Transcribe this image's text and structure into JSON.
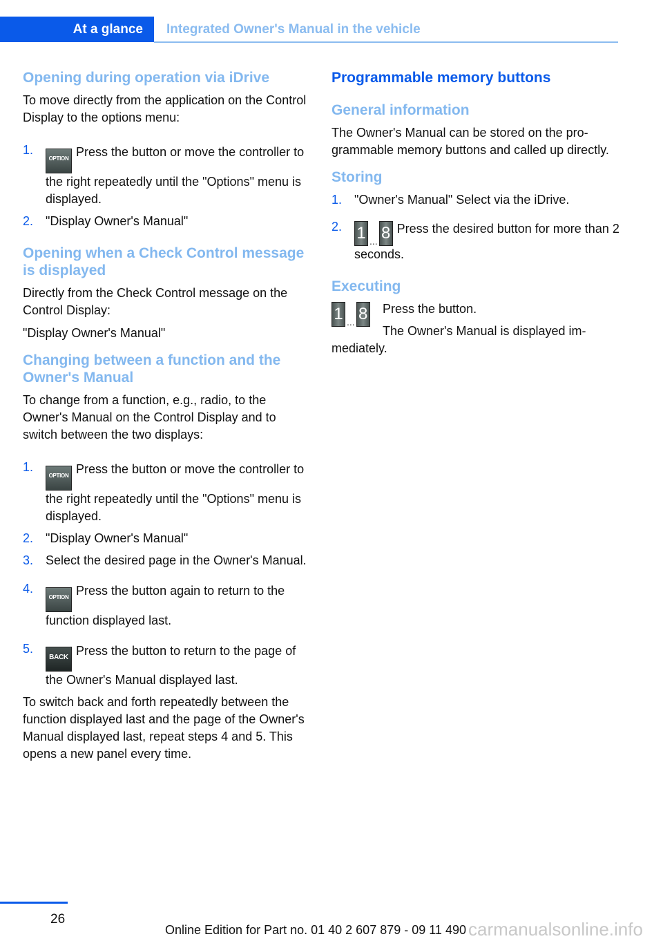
{
  "header": {
    "section_tab": "At a glance",
    "chapter_title": "Integrated Owner's Manual in the vehicle",
    "accent_color": "#0a5ae9",
    "light_accent_color": "#8bbcf0"
  },
  "left": {
    "s1": {
      "title": "Opening during operation via iDrive",
      "intro": "To move directly from the application on the Control Display to the options menu:",
      "steps": [
        {
          "num": "1.",
          "button": "OPTION",
          "text": "Press the button or move the controller to the right repeatedly until the \"Options\" menu is displayed."
        },
        {
          "num": "2.",
          "text": "\"Display Owner's Manual\""
        }
      ]
    },
    "s2": {
      "title": "Opening when a Check Control message is displayed",
      "p1": "Directly from the Check Control message on the Control Display:",
      "p2": "\"Display Owner's Manual\""
    },
    "s3": {
      "title": "Changing between a function and the Owner's Manual",
      "intro": "To change from a function, e.g., radio, to the Owner's Manual on the Control Display and to switch between the two displays:",
      "steps": [
        {
          "num": "1.",
          "button": "OPTION",
          "text": "Press the button or move the controller to the right repeatedly until the \"Options\" menu is displayed."
        },
        {
          "num": "2.",
          "text": "\"Display Owner's Manual\""
        },
        {
          "num": "3.",
          "text": "Select the desired page in the Owner's Manual."
        },
        {
          "num": "4.",
          "button": "OPTION",
          "text": "Press the button again to return to the function displayed last."
        },
        {
          "num": "5.",
          "button": "BACK",
          "text": "Press the button to return to the page of the Owner's Manual displayed last."
        }
      ],
      "outro": "To switch back and forth repeatedly between the function displayed last and the page of the Owner's Manual displayed last, repeat steps 4 and 5. This opens a new panel every time."
    }
  },
  "right": {
    "title": "Programmable memory buttons",
    "general": {
      "title": "General information",
      "text": "The Owner's Manual can be stored on the pro­grammable memory buttons and called up di­rectly."
    },
    "storing": {
      "title": "Storing",
      "steps": [
        {
          "num": "1.",
          "text": "\"Owner's Manual\" Select via the iDrive."
        },
        {
          "num": "2.",
          "key_first": "1",
          "key_dots": "...",
          "key_last": "8",
          "text": "Press the desired button for more than 2 seconds."
        }
      ]
    },
    "executing": {
      "title": "Executing",
      "key_first": "1",
      "key_dots": "...",
      "key_last": "8",
      "line1": "Press the button.",
      "line2": "The Owner's Manual is displayed im-",
      "line3": "mediately."
    }
  },
  "footer": {
    "page_number": "26",
    "edition": "Online Edition for Part no. 01 40 2 607 879 - 09 11 490",
    "watermark": "carmanualsonline.info"
  }
}
